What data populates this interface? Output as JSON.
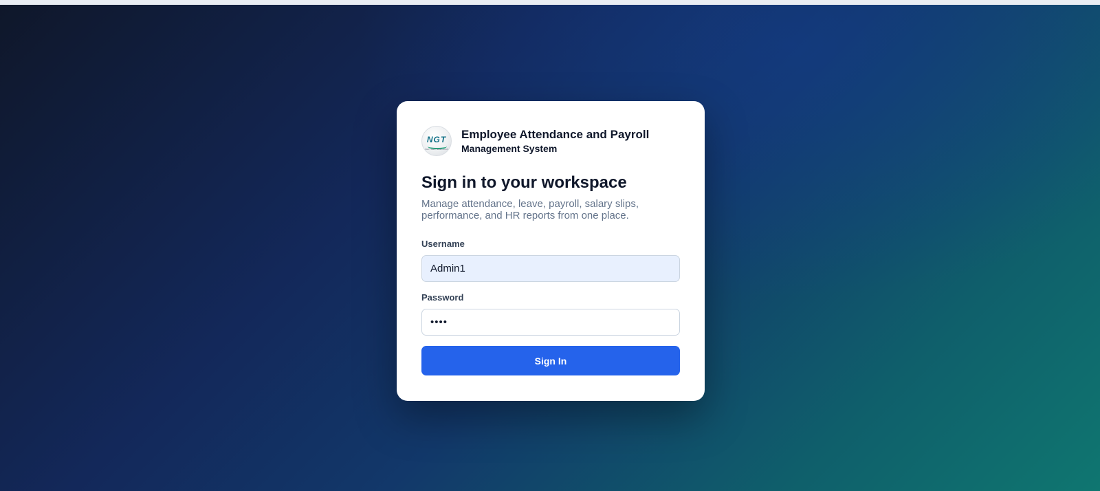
{
  "brand": {
    "logo_text": "NGT",
    "logo_tagline": "NEXT GEN TEMPLATES",
    "title": "Employee Attendance and Payroll",
    "subtitle": "Management System"
  },
  "login": {
    "heading": "Sign in to your workspace",
    "description": "Manage attendance, leave, payroll, salary slips, performance, and HR reports from one place.",
    "username_label": "Username",
    "username_value": "Admin1",
    "password_label": "Password",
    "password_value": "1234",
    "submit_label": "Sign In"
  },
  "colors": {
    "accent": "#2563eb",
    "autofill_bg": "#e8f0fe",
    "text_dark": "#0f172a",
    "text_muted": "#64748b"
  }
}
